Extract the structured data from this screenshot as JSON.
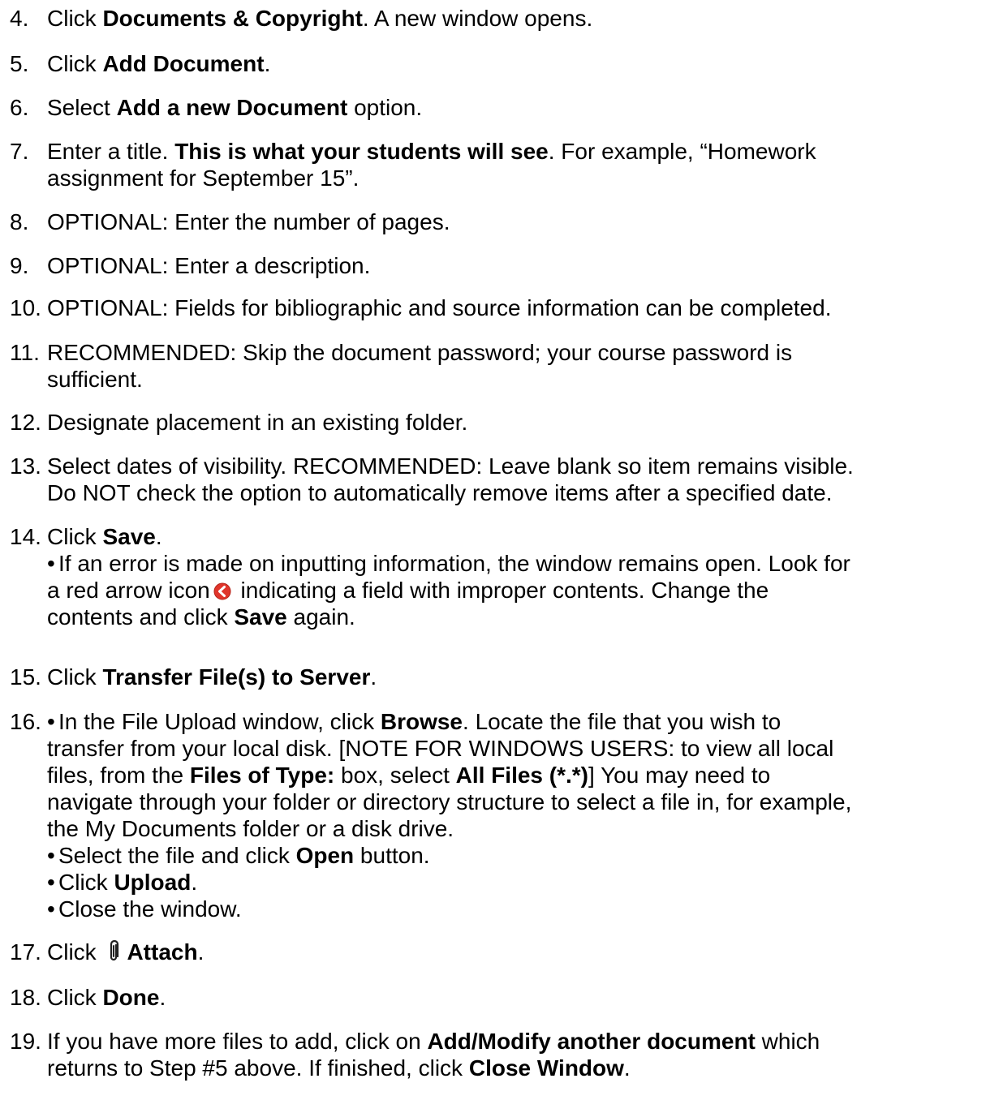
{
  "steps": [
    {
      "num": "4.",
      "parts": [
        "Click ",
        "Documents & Copyright",
        ".  A new window opens."
      ]
    },
    {
      "num": "5.",
      "parts": [
        "Click ",
        "Add Document",
        "."
      ]
    },
    {
      "num": "6.",
      "parts": [
        "Select ",
        "Add a new Document",
        " option."
      ]
    },
    {
      "num": "7.",
      "parts": [
        "Enter a title.  ",
        "This is what your students will see",
        ".  For example, “Homework",
        "assignment for September 15”."
      ]
    },
    {
      "num": "8.",
      "text": "OPTIONAL: Enter the number of pages."
    },
    {
      "num": "9.",
      "text": "OPTIONAL: Enter a description."
    },
    {
      "num": "10.",
      "text": "OPTIONAL:  Fields for bibliographic and source information can be completed."
    },
    {
      "num": "11.",
      "lines": [
        "RECOMMENDED:  Skip the document password; your course password is",
        "sufficient."
      ]
    },
    {
      "num": "12.",
      "text": "Designate placement in an existing folder."
    },
    {
      "num": "13.",
      "lines": [
        "Select dates of visibility.  RECOMMENDED: Leave blank so item remains visible.",
        "Do NOT check the option to automatically remove items after a specified date."
      ]
    },
    {
      "num": "14.",
      "parts": [
        "Click ",
        "Save",
        ".",
        "If an error is made on inputting information, the window remains open.  Look for",
        "a red arrow icon",
        " indicating a field with improper contents.  Change the",
        "contents and click ",
        "Save",
        " again."
      ]
    },
    {
      "num": "15.",
      "parts": [
        "Click ",
        "Transfer File(s) to Server",
        "."
      ]
    },
    {
      "num": "16.",
      "parts": [
        "In the File Upload window, click ",
        "Browse",
        ".  Locate the file that you wish to",
        "transfer from your local disk.  [NOTE FOR WINDOWS USERS: to view all local",
        "files, from the ",
        "Files of Type:",
        " box, select ",
        "All Files (*.*)",
        "]  You may need to",
        "navigate through your folder or directory structure to select a file in, for example,",
        "the My Documents folder or a disk drive.",
        "Select the file and click ",
        "Open",
        " button.",
        "Click ",
        "Upload",
        ".",
        "Close the window."
      ]
    },
    {
      "num": "17.",
      "parts": [
        "Click ",
        "Attach",
        "."
      ]
    },
    {
      "num": "18.",
      "parts": [
        "Click ",
        "Done",
        "."
      ]
    },
    {
      "num": "19.",
      "parts": [
        "If you have more files to add, click on ",
        "Add/Modify another document",
        " which",
        "returns to Step #5 above.  If finished, click ",
        "Close Window",
        "."
      ]
    }
  ],
  "icons": {
    "error_arrow": "red-arrow-icon",
    "attach": "paperclip-icon"
  },
  "colors": {
    "error_arrow": "#e0352b"
  }
}
